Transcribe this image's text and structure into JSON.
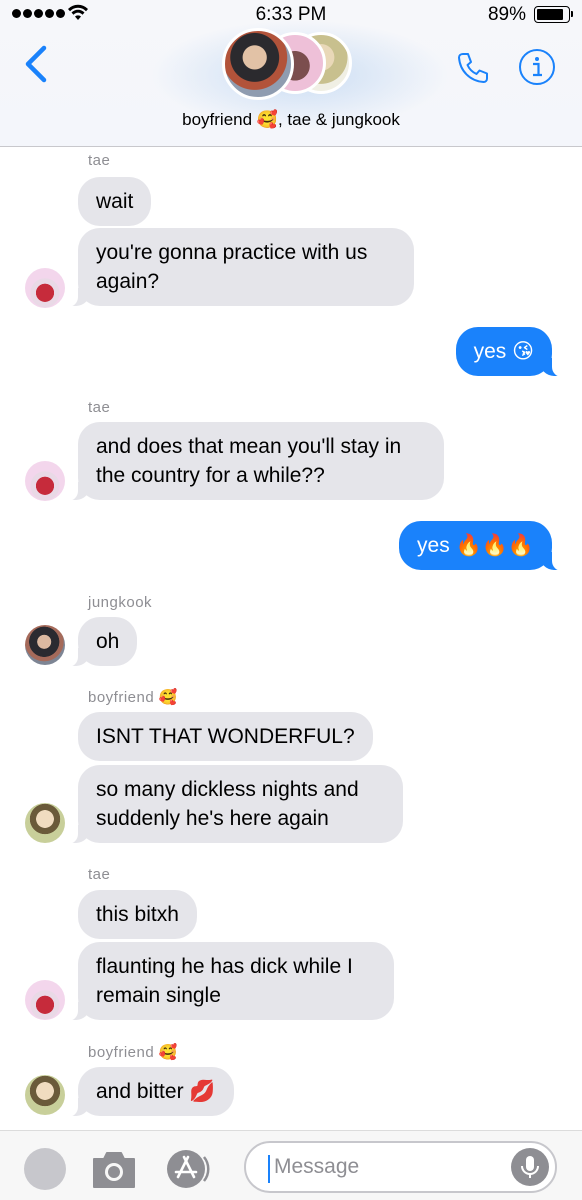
{
  "status_bar": {
    "time": "6:33 PM",
    "battery": "89%"
  },
  "header": {
    "title": "boyfriend 🥰, tae & jungkook",
    "accent_color": "#1a82fb"
  },
  "messages": [
    {
      "sender": "tae",
      "text": "wait"
    },
    {
      "text": "you're gonna practice with us",
      "text2": "again?"
    },
    {
      "text": "yes 😘"
    },
    {
      "sender": "tae",
      "text": "and does that mean you'll stay in",
      "text2": "the country for a while??"
    },
    {
      "text": "yes 🔥🔥🔥"
    },
    {
      "sender": "jungkook",
      "text": "oh"
    },
    {
      "sender": "boyfriend 🥰",
      "text": "ISNT THAT WONDERFUL?"
    },
    {
      "text": "so many dickless nights and",
      "text2": "suddenly he's here again"
    },
    {
      "sender": "tae",
      "text": "this bitxh"
    },
    {
      "text": "flaunting he has dick while I",
      "text2": "remain single"
    },
    {
      "sender": "boyfriend 🥰",
      "text": "and bitter 💋"
    }
  ],
  "input": {
    "placeholder": "Message"
  },
  "colors": {
    "incoming_bubble": "#e5e5ea",
    "outgoing_bubble": "#1a82fb",
    "sender_label": "#8e8e93"
  },
  "icons": [
    "back-chevron-icon",
    "phone-icon",
    "info-icon",
    "camera-icon",
    "app-store-icon",
    "microphone-icon",
    "wifi-icon",
    "battery-icon",
    "signal-icon"
  ]
}
